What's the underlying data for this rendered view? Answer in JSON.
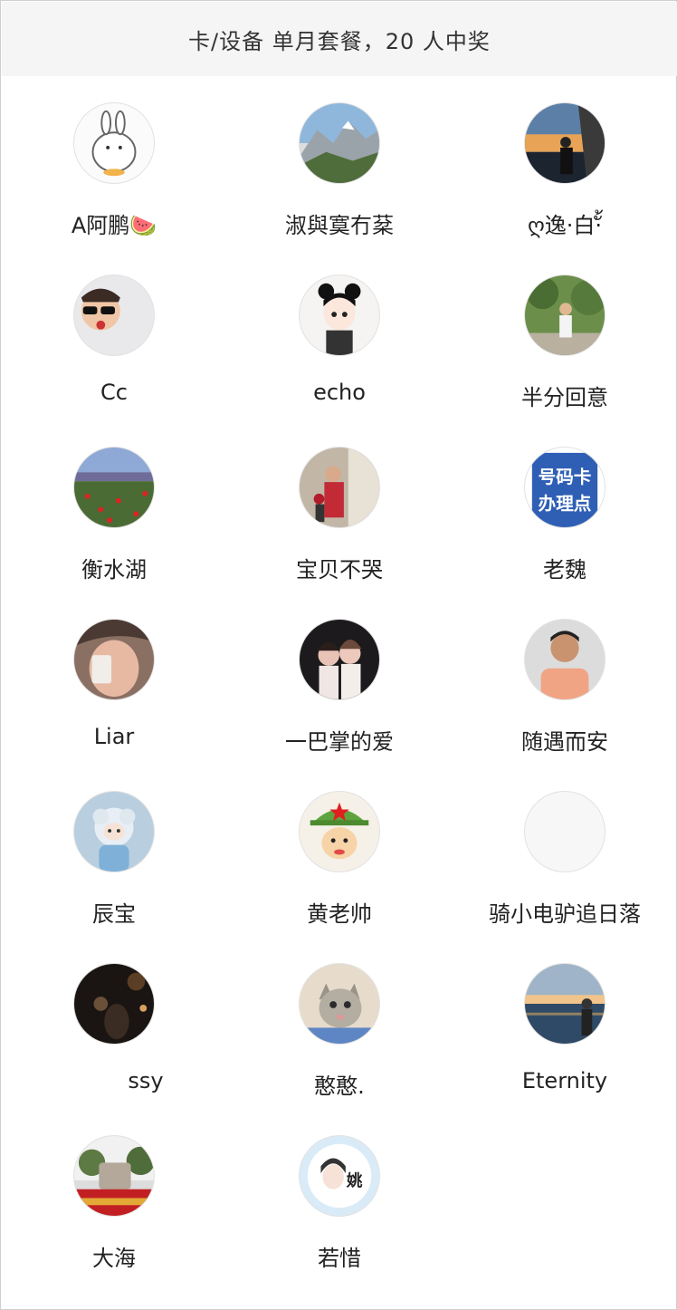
{
  "header": {
    "title": "卡/设备 单月套餐，20 人中奖"
  },
  "winners": [
    {
      "name": "A阿鹏🍉",
      "avatar": "bunny-cartoon-avatar"
    },
    {
      "name": "淑與寞冇棻",
      "avatar": "mountain-landscape-avatar"
    },
    {
      "name": "ღ逸·白·ั้",
      "avatar": "sunset-silhouette-avatar"
    },
    {
      "name": "Cc",
      "avatar": "child-sunglasses-avatar"
    },
    {
      "name": "echo",
      "avatar": "anime-girl-avatar"
    },
    {
      "name": "半分回意",
      "avatar": "child-garden-avatar"
    },
    {
      "name": "衡水湖",
      "avatar": "flower-field-avatar"
    },
    {
      "name": "宝贝不哭",
      "avatar": "family-photo-avatar"
    },
    {
      "name": "老魏",
      "avatar": "phone-card-sign-avatar"
    },
    {
      "name": "Liar",
      "avatar": "man-selfie-avatar"
    },
    {
      "name": "一巴掌的爱",
      "avatar": "couple-photo-avatar"
    },
    {
      "name": "随遇而安",
      "avatar": "man-portrait-avatar"
    },
    {
      "name": "辰宝",
      "avatar": "sheep-doll-avatar"
    },
    {
      "name": "黄老帅",
      "avatar": "cartoon-soldier-avatar"
    },
    {
      "name": "骑小电驴追日落",
      "avatar": "blank-avatar"
    },
    {
      "name": "ssy",
      "avatar": "night-street-avatar"
    },
    {
      "name": "憨憨.",
      "avatar": "cat-avatar"
    },
    {
      "name": "Eternity",
      "avatar": "seaside-sunset-avatar"
    },
    {
      "name": "大海",
      "avatar": "monument-avatar"
    },
    {
      "name": "若惜",
      "avatar": "girl-sticker-avatar"
    }
  ],
  "colors": {
    "header_bg": "#f5f5f5",
    "text": "#222222"
  }
}
